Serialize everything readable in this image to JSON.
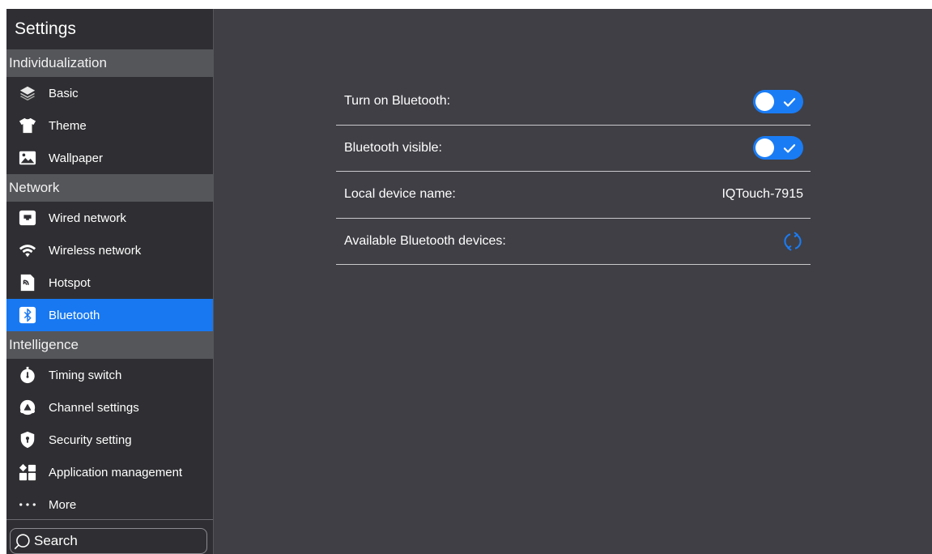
{
  "sidebar": {
    "title": "Settings",
    "sections": [
      {
        "header": "Individualization",
        "items": [
          {
            "label": "Basic",
            "icon": "layers-icon"
          },
          {
            "label": "Theme",
            "icon": "tshirt-icon"
          },
          {
            "label": "Wallpaper",
            "icon": "image-icon"
          }
        ]
      },
      {
        "header": "Network",
        "items": [
          {
            "label": "Wired network",
            "icon": "ethernet-icon"
          },
          {
            "label": "Wireless network",
            "icon": "wifi-icon"
          },
          {
            "label": "Hotspot",
            "icon": "hotspot-icon"
          },
          {
            "label": "Bluetooth",
            "icon": "bluetooth-icon",
            "active": true
          }
        ]
      },
      {
        "header": "Intelligence",
        "items": [
          {
            "label": "Timing switch",
            "icon": "stopwatch-icon"
          },
          {
            "label": "Channel settings",
            "icon": "channel-icon"
          },
          {
            "label": "Security setting",
            "icon": "shield-icon"
          },
          {
            "label": "Application management",
            "icon": "apps-icon"
          },
          {
            "label": "More",
            "icon": "more-dots-icon"
          }
        ]
      }
    ],
    "search": {
      "placeholder": "Search"
    }
  },
  "bluetooth": {
    "turn_on_label": "Turn on Bluetooth:",
    "turn_on_state": true,
    "visible_label": "Bluetooth visible:",
    "visible_state": true,
    "device_name_label": "Local device name:",
    "device_name_value": "IQTouch-7915",
    "available_label": "Available Bluetooth devices:"
  },
  "colors": {
    "accent": "#1778f2",
    "sidebar_bg": "#2f2f33",
    "section_bg": "#55565a",
    "main_bg": "#3f3f45"
  }
}
